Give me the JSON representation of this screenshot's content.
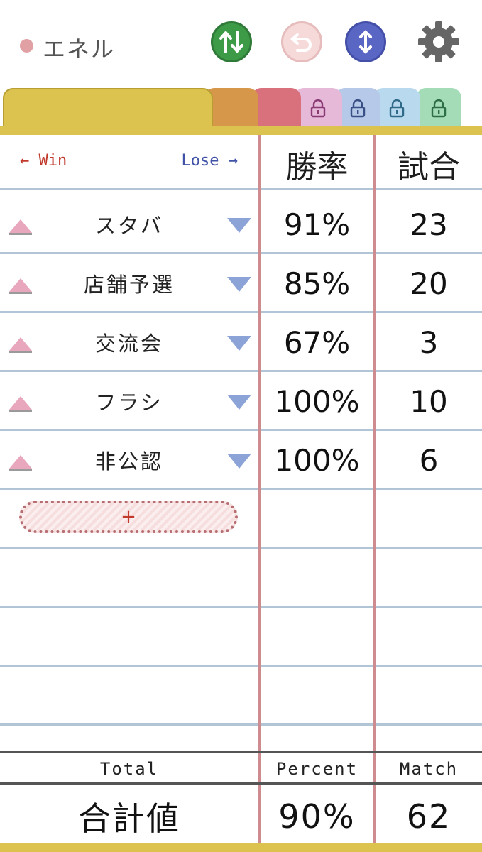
{
  "header": {
    "player_name": "エネル",
    "player_dot_color": "#e0a0a4",
    "buttons": [
      {
        "name": "sort-button",
        "icon": "up-down-arrows-icon",
        "color": "#3d9a47"
      },
      {
        "name": "undo-button",
        "icon": "undo-icon",
        "color": "#f6dada"
      },
      {
        "name": "swap-button",
        "icon": "vertical-arrows-icon",
        "color": "#5a66c4"
      },
      {
        "name": "settings-button",
        "icon": "gear-icon",
        "color": "#666666"
      }
    ]
  },
  "tabs": [
    {
      "color": "#dcc24f",
      "locked": false,
      "active": true
    },
    {
      "color": "#d6974a",
      "locked": false
    },
    {
      "color": "#d9717c",
      "locked": false
    },
    {
      "color": "#e6b9d8",
      "locked": true
    },
    {
      "color": "#b6c9e8",
      "locked": true
    },
    {
      "color": "#b8d9ee",
      "locked": true
    },
    {
      "color": "#a4dcb8",
      "locked": true
    }
  ],
  "table": {
    "win_hint": "← Win",
    "lose_hint": "Lose →",
    "col_rate": "勝率",
    "col_games": "試合",
    "rows": [
      {
        "name": "スタバ",
        "rate": "91%",
        "games": "23"
      },
      {
        "name": "店舗予選",
        "rate": "85%",
        "games": "20"
      },
      {
        "name": "交流会",
        "rate": "67%",
        "games": "3"
      },
      {
        "name": "フラシ",
        "rate": "100%",
        "games": "10"
      },
      {
        "name": "非公認",
        "rate": "100%",
        "games": "6"
      }
    ],
    "add_label": "+"
  },
  "footer": {
    "total_label": "Total",
    "percent_label": "Percent",
    "match_label": "Match",
    "total_name": "合計値",
    "total_rate": "90%",
    "total_games": "62"
  }
}
